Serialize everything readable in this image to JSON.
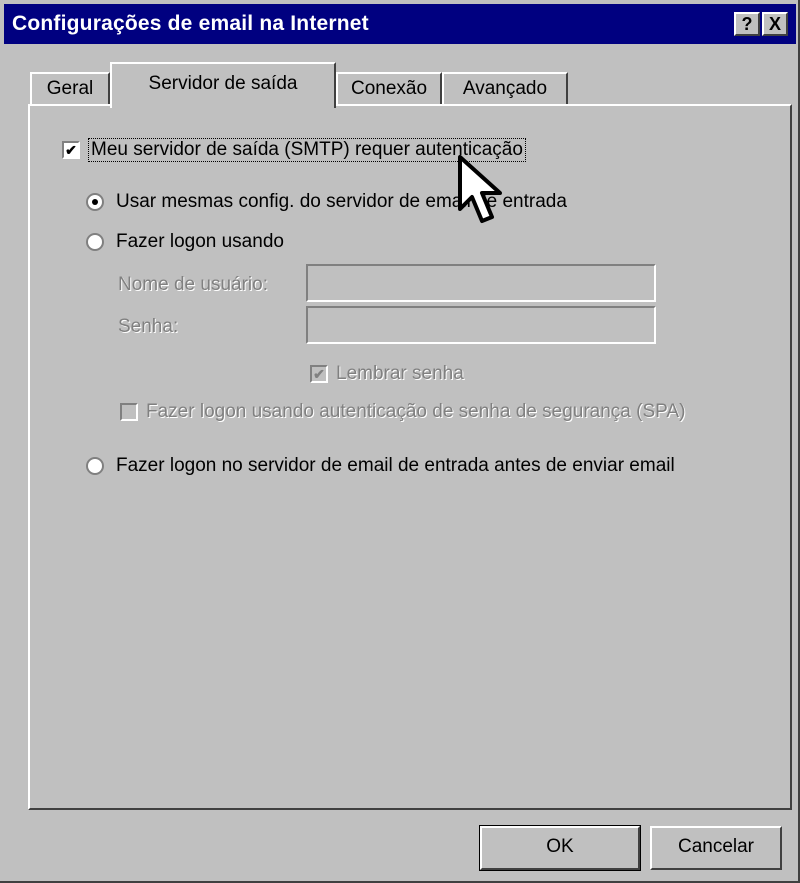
{
  "window": {
    "title": "Configurações de email na Internet",
    "help_label": "?",
    "close_label": "X"
  },
  "tabs": [
    {
      "label": "Geral"
    },
    {
      "label": "Servidor de saída"
    },
    {
      "label": "Conexão"
    },
    {
      "label": "Avançado"
    }
  ],
  "smtp_auth": {
    "label": "Meu servidor de saída (SMTP) requer autenticação",
    "checked": true
  },
  "options": {
    "same_config": {
      "label": "Usar mesmas config. do servidor de email de entrada",
      "selected": true
    },
    "logon_using": {
      "label": "Fazer logon usando",
      "selected": false
    },
    "logon_before_send": {
      "label": "Fazer logon no servidor de email de entrada antes de enviar email",
      "selected": false
    }
  },
  "fields": {
    "username": {
      "label": "Nome de usuário:",
      "value": ""
    },
    "password": {
      "label": "Senha:",
      "value": ""
    }
  },
  "remember_password": {
    "label": "Lembrar senha",
    "checked": true
  },
  "spa": {
    "label": "Fazer logon usando autenticação de senha de segurança (SPA)",
    "checked": false
  },
  "buttons": {
    "ok": "OK",
    "cancel": "Cancelar"
  },
  "icons": {
    "help": "help-icon",
    "close": "close-icon",
    "cursor": "mouse-cursor-icon"
  },
  "colors": {
    "titlebar": "#000080",
    "face": "#c0c0c0",
    "disabled_text": "#808080"
  }
}
